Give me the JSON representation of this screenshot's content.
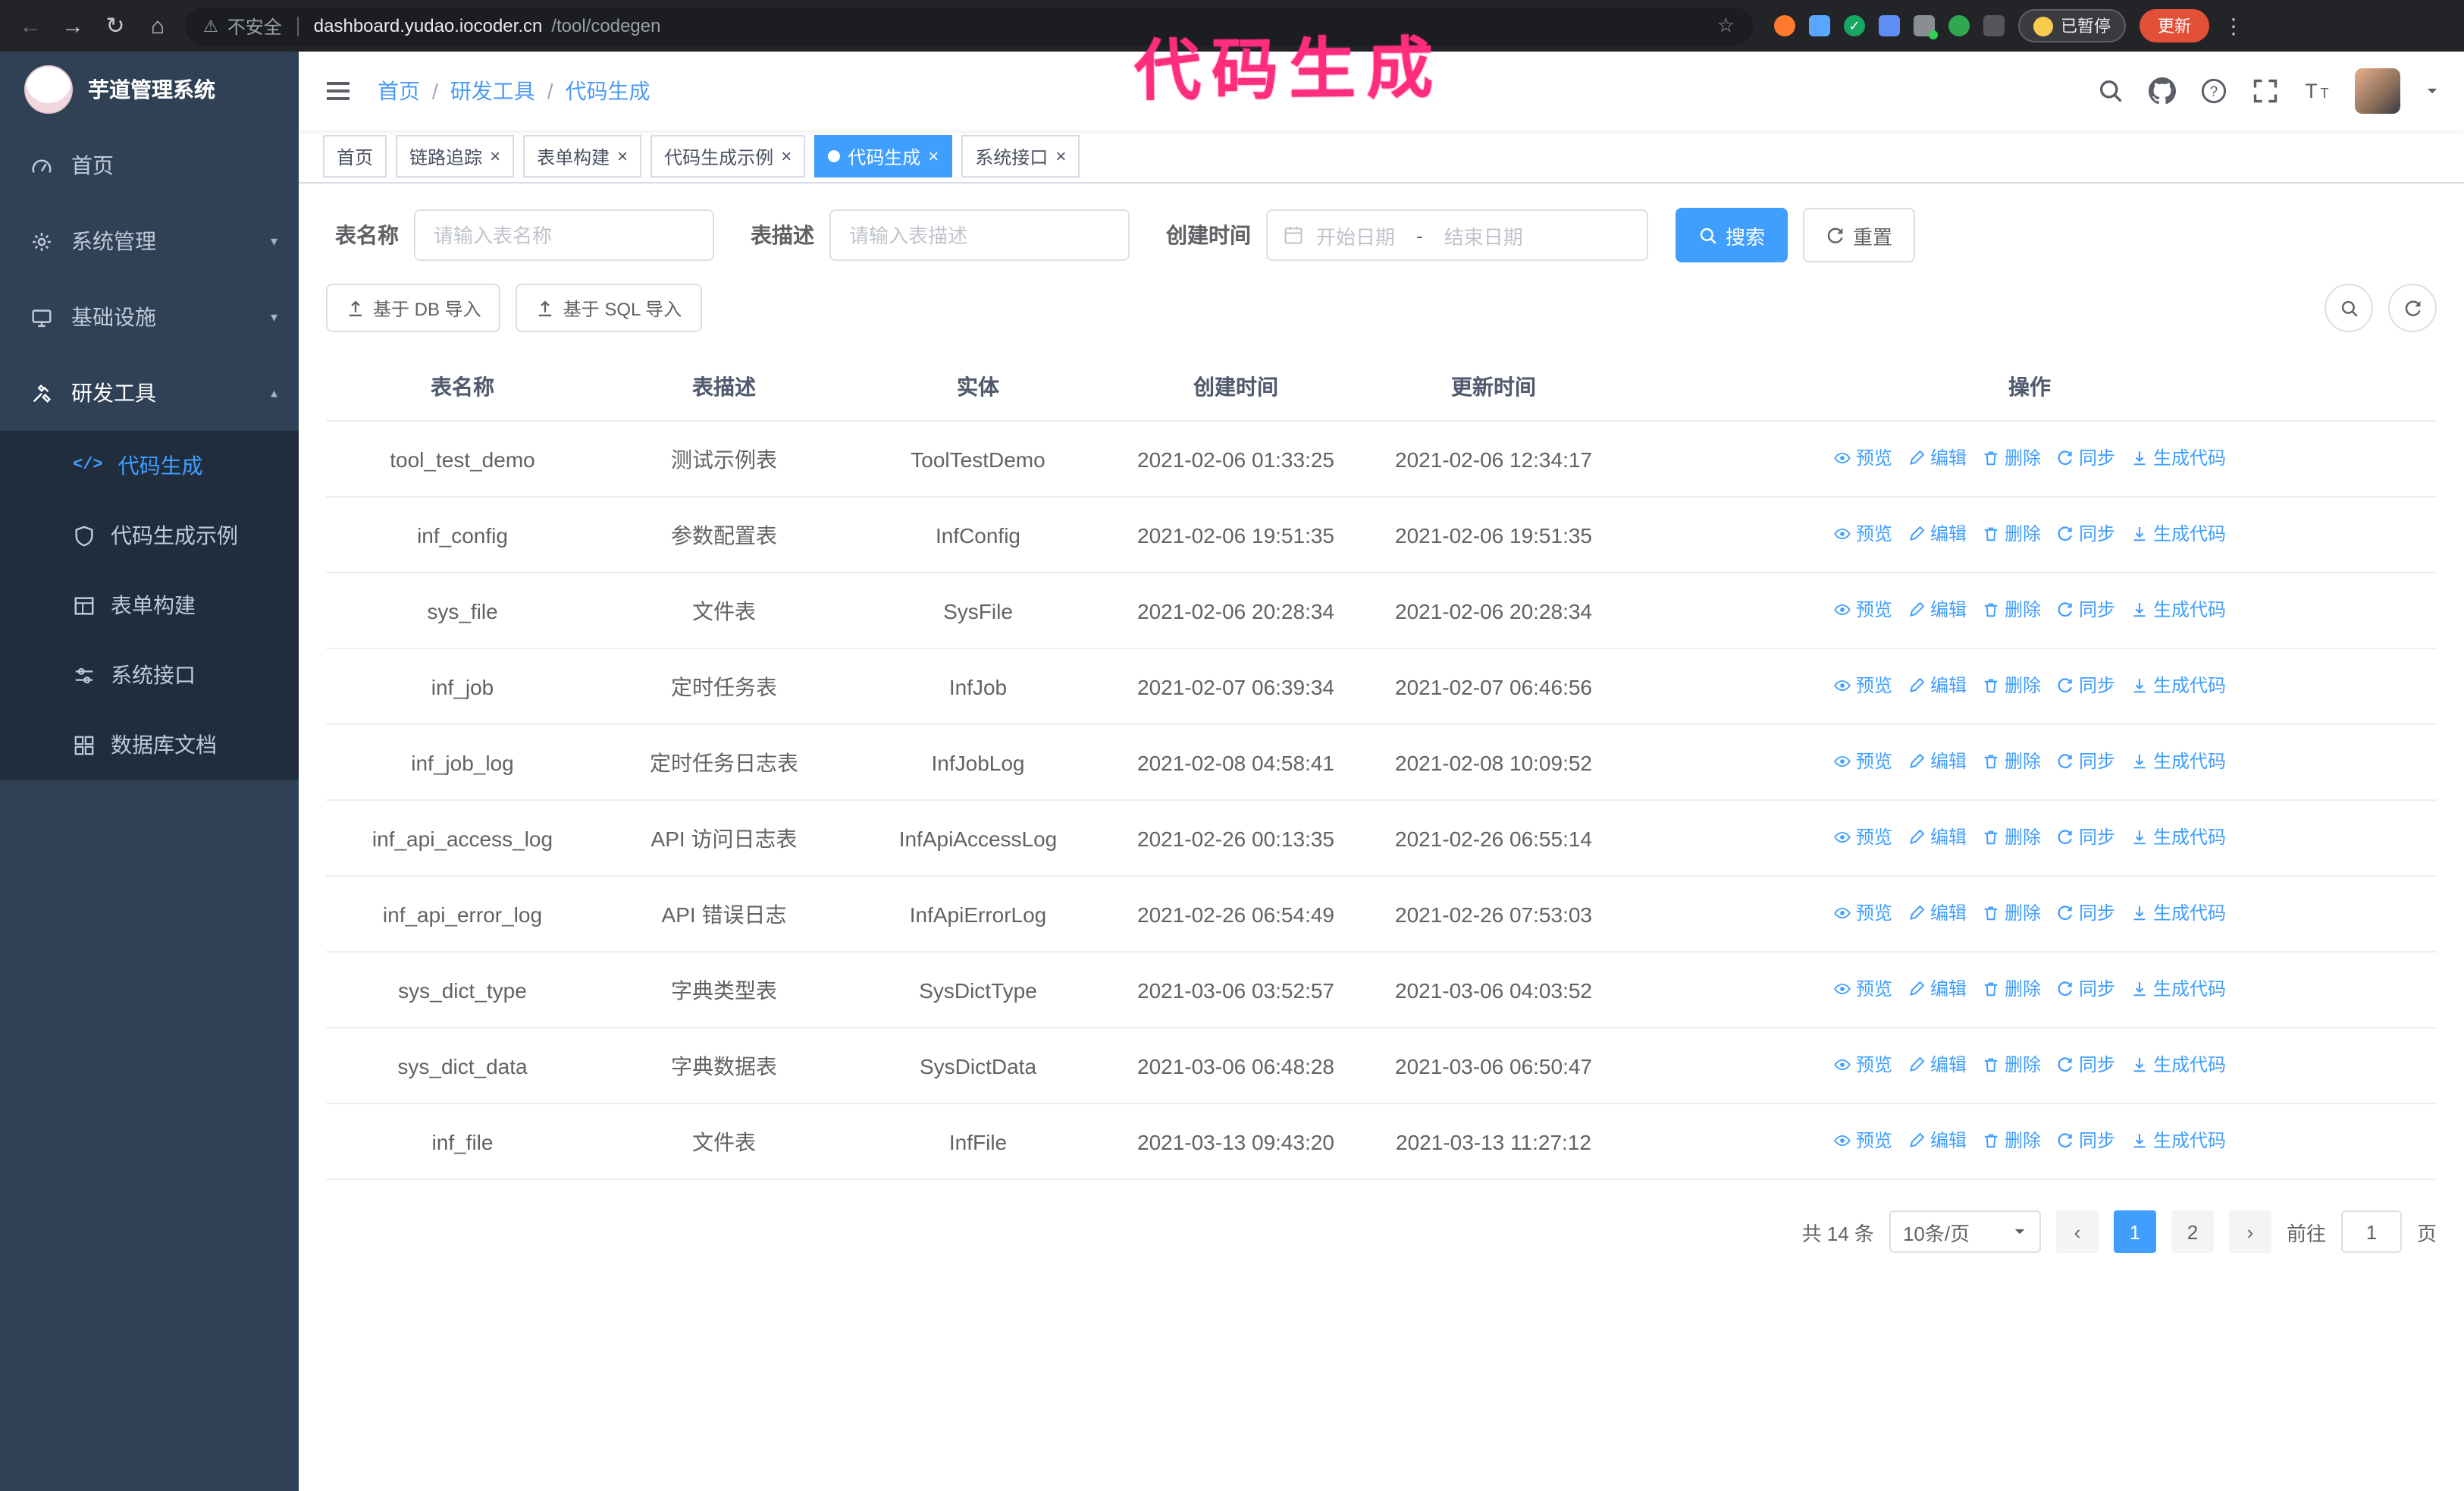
{
  "annotation": {
    "text": "代码生成",
    "color": "#ff2d7d"
  },
  "browser": {
    "security_label": "不安全",
    "url_host": "dashboard.yudao.iocoder.cn",
    "url_path": "/tool/codegen",
    "paused_badge": "已暂停",
    "update_button": "更新",
    "nav_icons": [
      "back-icon",
      "forward-icon",
      "reload-icon",
      "home-icon"
    ]
  },
  "sidebar": {
    "logo_title": "芋道管理系统",
    "items": [
      {
        "label": "首页",
        "icon": "dashboard-icon"
      },
      {
        "label": "系统管理",
        "icon": "gear-icon",
        "chevron": "down"
      },
      {
        "label": "基础设施",
        "icon": "infrastructure-icon",
        "chevron": "down"
      },
      {
        "label": "研发工具",
        "icon": "tools-icon",
        "chevron": "up",
        "expanded": true
      }
    ],
    "submenu": [
      {
        "label": "代码生成",
        "icon": "code-icon",
        "active": true
      },
      {
        "label": "代码生成示例",
        "icon": "shield-icon"
      },
      {
        "label": "表单构建",
        "icon": "form-icon"
      },
      {
        "label": "系统接口",
        "icon": "api-icon"
      },
      {
        "label": "数据库文档",
        "icon": "database-icon"
      }
    ]
  },
  "header": {
    "breadcrumb": [
      "首页",
      "研发工具",
      "代码生成"
    ],
    "icons": [
      "search-icon",
      "github-icon",
      "help-icon",
      "fullscreen-icon",
      "font-size-icon",
      "avatar",
      "caret-down-icon"
    ]
  },
  "tabs": [
    {
      "label": "首页",
      "closable": false,
      "active": false
    },
    {
      "label": "链路追踪",
      "closable": true,
      "active": false
    },
    {
      "label": "表单构建",
      "closable": true,
      "active": false
    },
    {
      "label": "代码生成示例",
      "closable": true,
      "active": false
    },
    {
      "label": "代码生成",
      "closable": true,
      "active": true
    },
    {
      "label": "系统接口",
      "closable": true,
      "active": false
    }
  ],
  "filters": {
    "table_name_label": "表名称",
    "table_name_placeholder": "请输入表名称",
    "table_desc_label": "表描述",
    "table_desc_placeholder": "请输入表描述",
    "create_time_label": "创建时间",
    "date_start_placeholder": "开始日期",
    "date_separator": "-",
    "date_end_placeholder": "结束日期",
    "search_button": "搜索",
    "reset_button": "重置"
  },
  "toolbar": {
    "import_db_button": "基于 DB 导入",
    "import_sql_button": "基于 SQL 导入",
    "icon_buttons": [
      "search-toggle-icon",
      "refresh-icon"
    ]
  },
  "table": {
    "columns": [
      "表名称",
      "表描述",
      "实体",
      "创建时间",
      "更新时间",
      "操作"
    ],
    "actions": [
      {
        "label": "预览",
        "name": "preview",
        "icon": "eye-icon"
      },
      {
        "label": "编辑",
        "name": "edit",
        "icon": "edit-icon"
      },
      {
        "label": "删除",
        "name": "delete",
        "icon": "delete-icon"
      },
      {
        "label": "同步",
        "name": "sync",
        "icon": "sync-icon"
      },
      {
        "label": "生成代码",
        "name": "generate-code",
        "icon": "download-icon"
      }
    ],
    "rows": [
      {
        "name": "tool_test_demo",
        "desc": "测试示例表",
        "entity": "ToolTestDemo",
        "created": "2021-02-06 01:33:25",
        "updated": "2021-02-06 12:34:17",
        "created_wrap": false,
        "updated_wrap": false
      },
      {
        "name": "inf_config",
        "desc": "参数配置表",
        "entity": "InfConfig",
        "created": "2021-02-06 19:51:35",
        "updated": "2021-02-06 19:51:35",
        "created_wrap": false,
        "updated_wrap": false
      },
      {
        "name": "sys_file",
        "desc": "文件表",
        "entity": "SysFile",
        "created": "2021-02-06 20:28:34",
        "updated": "2021-02-06 20:28:34",
        "created_wrap": true,
        "updated_wrap": true
      },
      {
        "name": "inf_job",
        "desc": "定时任务表",
        "entity": "InfJob",
        "created": "2021-02-07 06:39:34",
        "updated": "2021-02-07 06:46:56",
        "created_wrap": true,
        "updated_wrap": true
      },
      {
        "name": "inf_job_log",
        "desc": "定时任务日志表",
        "entity": "InfJobLog",
        "created": "2021-02-08 04:58:41",
        "updated": "2021-02-08 10:09:52",
        "created_wrap": true,
        "updated_wrap": true
      },
      {
        "name": "inf_api_access_log",
        "desc": "API 访问日志表",
        "entity": "InfApiAccessLog",
        "created": "2021-02-26 00:13:35",
        "updated": "2021-02-26 06:55:14",
        "created_wrap": false,
        "updated_wrap": true
      },
      {
        "name": "inf_api_error_log",
        "desc": "API 错误日志",
        "entity": "InfApiErrorLog",
        "created": "2021-02-26 06:54:49",
        "updated": "2021-02-26 07:53:03",
        "created_wrap": true,
        "updated_wrap": true
      },
      {
        "name": "sys_dict_type",
        "desc": "字典类型表",
        "entity": "SysDictType",
        "created": "2021-03-06 03:52:57",
        "updated": "2021-03-06 04:03:52",
        "created_wrap": true,
        "updated_wrap": true
      },
      {
        "name": "sys_dict_data",
        "desc": "字典数据表",
        "entity": "SysDictData",
        "created": "2021-03-06 06:48:28",
        "updated": "2021-03-06 06:50:47",
        "created_wrap": true,
        "updated_wrap": true
      },
      {
        "name": "inf_file",
        "desc": "文件表",
        "entity": "InfFile",
        "created": "2021-03-13 09:43:20",
        "updated": "2021-03-13 11:27:12",
        "created_wrap": true,
        "updated_wrap": false
      }
    ]
  },
  "pagination": {
    "total_text": "共 14 条",
    "page_size": "10条/页",
    "prev": "‹",
    "next": "›",
    "pages": [
      "1",
      "2"
    ],
    "active_page": "1",
    "goto_label": "前往",
    "goto_value": "1",
    "goto_suffix": "页"
  },
  "colors": {
    "accent": "#409eff",
    "sidebar_bg": "#304156",
    "submenu_bg": "#1f2d3d",
    "annotation": "#ff2d7d",
    "update_button": "#e25038"
  }
}
